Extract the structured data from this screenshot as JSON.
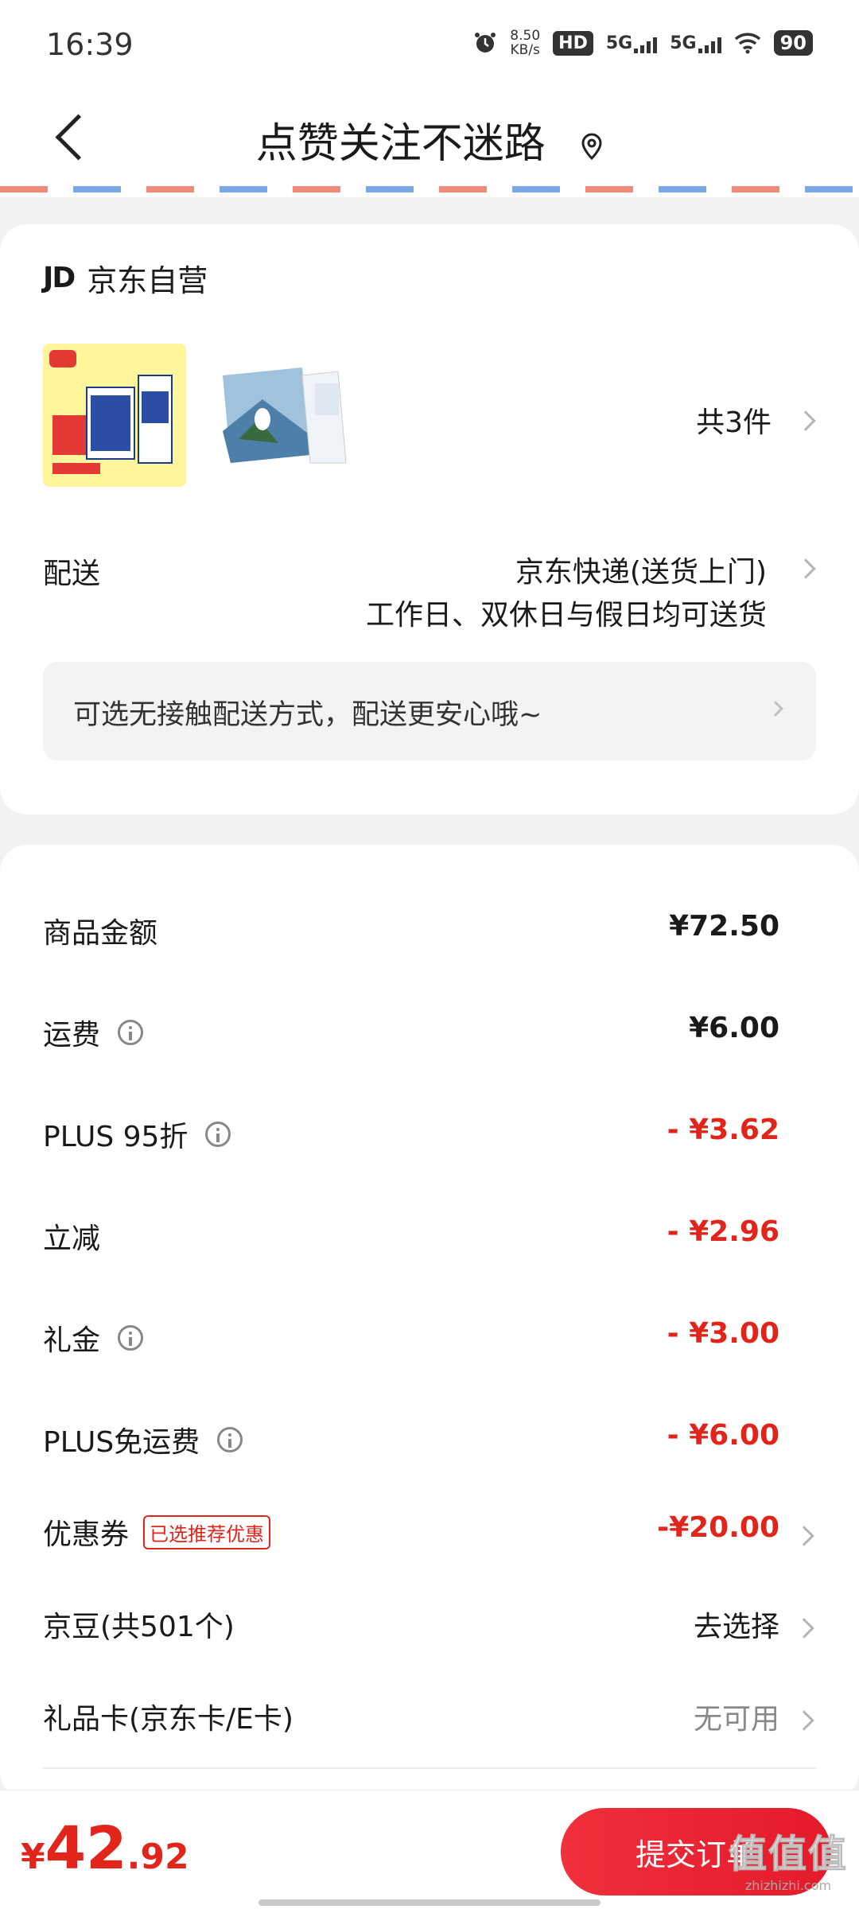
{
  "status_bar": {
    "time": "16:39",
    "speed_value": "8.50",
    "speed_unit": "KB/s",
    "hd_label": "HD",
    "net1": "5G",
    "net2": "5G",
    "battery": "90"
  },
  "header": {
    "title": "点赞关注不迷路"
  },
  "shop": {
    "logo": "JD",
    "name": "京东自营"
  },
  "items": {
    "count_label": "共3件"
  },
  "delivery": {
    "label": "配送",
    "method": "京东快递(送货上门)",
    "schedule": "工作日、双休日与假日均可送货",
    "notice": "可选无接触配送方式，配送更安心哦~"
  },
  "summary": {
    "goods_label": "商品金额",
    "goods_value": "¥72.50",
    "shipping_label": "运费",
    "shipping_value": "¥6.00",
    "plus_label": "PLUS 95折",
    "plus_value": "- ¥3.62",
    "instant_label": "立减",
    "instant_value": "- ¥2.96",
    "gift_label": "礼金",
    "gift_value": "- ¥3.00",
    "plus_ship_label": "PLUS免运费",
    "plus_ship_value": "- ¥6.00",
    "coupon_label": "优惠券",
    "coupon_tag": "已选推荐优惠",
    "coupon_value": "-¥20.00",
    "beans_label": "京豆(共501个)",
    "beans_value": "去选择",
    "giftcard_label": "礼品卡(京东卡/E卡)",
    "giftcard_value": "无可用"
  },
  "footer": {
    "currency": "¥",
    "total_int": "42",
    "total_dec": ".92",
    "submit_label": "提交订单",
    "watermark_site": "zhizhizhi.com"
  },
  "colors": {
    "accent": "#e1251b"
  }
}
